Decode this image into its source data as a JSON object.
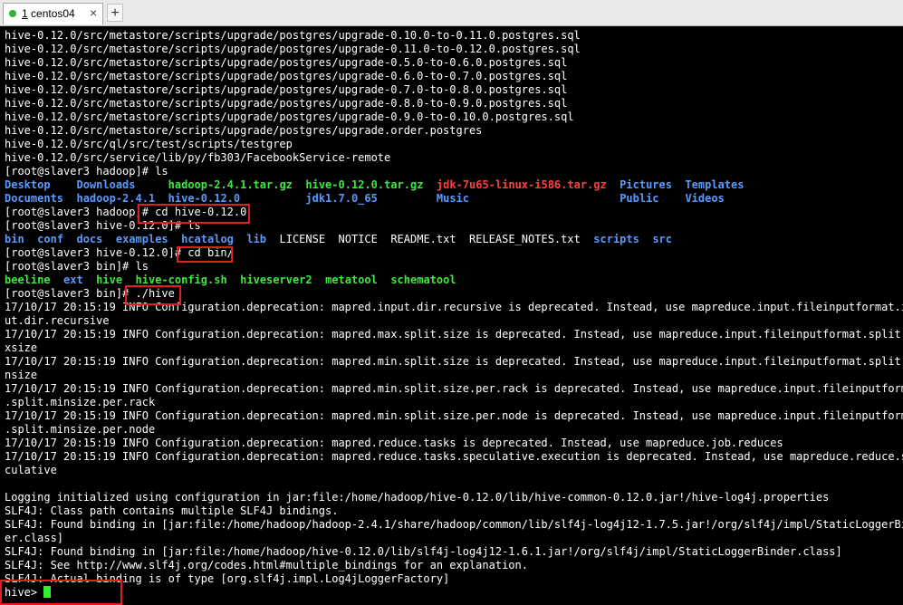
{
  "tabbar": {
    "tab_number": "1",
    "tab_title": " centos04",
    "close_glyph": "×",
    "add_glyph": "+",
    "status_color": "#2bb52b"
  },
  "terminal": {
    "colors": {
      "background": "#000000",
      "text": "#ffffff",
      "directory": "#5a9aff",
      "executable": "#3fe83f",
      "archive": "#ff4040",
      "highlight_box": "#e21f1f",
      "cursor": "#2ef22e"
    },
    "lines": [
      [
        {
          "t": "hive-0.12.0/src/metastore/scripts/upgrade/postgres/upgrade-0.10.0-to-0.11.0.postgres.sql",
          "c": "w"
        }
      ],
      [
        {
          "t": "hive-0.12.0/src/metastore/scripts/upgrade/postgres/upgrade-0.11.0-to-0.12.0.postgres.sql",
          "c": "w"
        }
      ],
      [
        {
          "t": "hive-0.12.0/src/metastore/scripts/upgrade/postgres/upgrade-0.5.0-to-0.6.0.postgres.sql",
          "c": "w"
        }
      ],
      [
        {
          "t": "hive-0.12.0/src/metastore/scripts/upgrade/postgres/upgrade-0.6.0-to-0.7.0.postgres.sql",
          "c": "w"
        }
      ],
      [
        {
          "t": "hive-0.12.0/src/metastore/scripts/upgrade/postgres/upgrade-0.7.0-to-0.8.0.postgres.sql",
          "c": "w"
        }
      ],
      [
        {
          "t": "hive-0.12.0/src/metastore/scripts/upgrade/postgres/upgrade-0.8.0-to-0.9.0.postgres.sql",
          "c": "w"
        }
      ],
      [
        {
          "t": "hive-0.12.0/src/metastore/scripts/upgrade/postgres/upgrade-0.9.0-to-0.10.0.postgres.sql",
          "c": "w"
        }
      ],
      [
        {
          "t": "hive-0.12.0/src/metastore/scripts/upgrade/postgres/upgrade.order.postgres",
          "c": "w"
        }
      ],
      [
        {
          "t": "hive-0.12.0/src/ql/src/test/scripts/testgrep",
          "c": "w"
        }
      ],
      [
        {
          "t": "hive-0.12.0/src/service/lib/py/fb303/FacebookService-remote",
          "c": "w"
        }
      ],
      [
        {
          "t": "[root@slaver3 hadoop]# ls",
          "c": "w"
        }
      ],
      [
        {
          "t": "Desktop",
          "c": "b"
        },
        {
          "t": "    ",
          "c": "w"
        },
        {
          "t": "Downloads",
          "c": "b"
        },
        {
          "t": "     ",
          "c": "w"
        },
        {
          "t": "hadoop-2.4.1.tar.gz",
          "c": "g"
        },
        {
          "t": "  ",
          "c": "w"
        },
        {
          "t": "hive-0.12.0.tar.gz",
          "c": "g"
        },
        {
          "t": "  ",
          "c": "w"
        },
        {
          "t": "jdk-7u65-linux-i586.tar.gz",
          "c": "r"
        },
        {
          "t": "  ",
          "c": "w"
        },
        {
          "t": "Pictures",
          "c": "b"
        },
        {
          "t": "  ",
          "c": "w"
        },
        {
          "t": "Templates",
          "c": "b"
        }
      ],
      [
        {
          "t": "Documents",
          "c": "b"
        },
        {
          "t": "  ",
          "c": "w"
        },
        {
          "t": "hadoop-2.4.1",
          "c": "b"
        },
        {
          "t": "  ",
          "c": "w"
        },
        {
          "t": "hive-0.12.0",
          "c": "b"
        },
        {
          "t": "          ",
          "c": "w"
        },
        {
          "t": "jdk1.7.0_65",
          "c": "b"
        },
        {
          "t": "         ",
          "c": "w"
        },
        {
          "t": "Music",
          "c": "b"
        },
        {
          "t": "                       ",
          "c": "w"
        },
        {
          "t": "Public",
          "c": "b"
        },
        {
          "t": "    ",
          "c": "w"
        },
        {
          "t": "Videos",
          "c": "b"
        }
      ],
      [
        {
          "t": "[root@slaver3 hadoop]# cd hive-0.12.0",
          "c": "w"
        }
      ],
      [
        {
          "t": "[root@slaver3 hive-0.12.0]# ls",
          "c": "w"
        }
      ],
      [
        {
          "t": "bin",
          "c": "b"
        },
        {
          "t": "  ",
          "c": "w"
        },
        {
          "t": "conf",
          "c": "b"
        },
        {
          "t": "  ",
          "c": "w"
        },
        {
          "t": "docs",
          "c": "b"
        },
        {
          "t": "  ",
          "c": "w"
        },
        {
          "t": "examples",
          "c": "b"
        },
        {
          "t": "  ",
          "c": "w"
        },
        {
          "t": "hcatalog",
          "c": "b"
        },
        {
          "t": "  ",
          "c": "w"
        },
        {
          "t": "lib",
          "c": "b"
        },
        {
          "t": "  LICENSE  NOTICE  README.txt  RELEASE_NOTES.txt  ",
          "c": "w"
        },
        {
          "t": "scripts",
          "c": "b"
        },
        {
          "t": "  ",
          "c": "w"
        },
        {
          "t": "src",
          "c": "b"
        }
      ],
      [
        {
          "t": "[root@slaver3 hive-0.12.0]# cd bin/",
          "c": "w"
        }
      ],
      [
        {
          "t": "[root@slaver3 bin]# ls",
          "c": "w"
        }
      ],
      [
        {
          "t": "beeline",
          "c": "g"
        },
        {
          "t": "  ",
          "c": "w"
        },
        {
          "t": "ext",
          "c": "b"
        },
        {
          "t": "  ",
          "c": "w"
        },
        {
          "t": "hive",
          "c": "g"
        },
        {
          "t": "  ",
          "c": "w"
        },
        {
          "t": "hive-config.sh",
          "c": "g"
        },
        {
          "t": "  ",
          "c": "w"
        },
        {
          "t": "hiveserver2",
          "c": "g"
        },
        {
          "t": "  ",
          "c": "w"
        },
        {
          "t": "metatool",
          "c": "g"
        },
        {
          "t": "  ",
          "c": "w"
        },
        {
          "t": "schematool",
          "c": "g"
        }
      ],
      [
        {
          "t": "[root@slaver3 bin]# ./hive",
          "c": "w"
        }
      ],
      [
        {
          "t": "17/10/17 20:15:19 INFO Configuration.deprecation: mapred.input.dir.recursive is deprecated. Instead, use mapreduce.input.fileinputformat.inp",
          "c": "w"
        }
      ],
      [
        {
          "t": "ut.dir.recursive",
          "c": "w"
        }
      ],
      [
        {
          "t": "17/10/17 20:15:19 INFO Configuration.deprecation: mapred.max.split.size is deprecated. Instead, use mapreduce.input.fileinputformat.split.ma",
          "c": "w"
        }
      ],
      [
        {
          "t": "xsize",
          "c": "w"
        }
      ],
      [
        {
          "t": "17/10/17 20:15:19 INFO Configuration.deprecation: mapred.min.split.size is deprecated. Instead, use mapreduce.input.fileinputformat.split.mi",
          "c": "w"
        }
      ],
      [
        {
          "t": "nsize",
          "c": "w"
        }
      ],
      [
        {
          "t": "17/10/17 20:15:19 INFO Configuration.deprecation: mapred.min.split.size.per.rack is deprecated. Instead, use mapreduce.input.fileinputformat",
          "c": "w"
        }
      ],
      [
        {
          "t": ".split.minsize.per.rack",
          "c": "w"
        }
      ],
      [
        {
          "t": "17/10/17 20:15:19 INFO Configuration.deprecation: mapred.min.split.size.per.node is deprecated. Instead, use mapreduce.input.fileinputformat",
          "c": "w"
        }
      ],
      [
        {
          "t": ".split.minsize.per.node",
          "c": "w"
        }
      ],
      [
        {
          "t": "17/10/17 20:15:19 INFO Configuration.deprecation: mapred.reduce.tasks is deprecated. Instead, use mapreduce.job.reduces",
          "c": "w"
        }
      ],
      [
        {
          "t": "17/10/17 20:15:19 INFO Configuration.deprecation: mapred.reduce.tasks.speculative.execution is deprecated. Instead, use mapreduce.reduce.spe",
          "c": "w"
        }
      ],
      [
        {
          "t": "culative",
          "c": "w"
        }
      ],
      [
        {
          "t": "",
          "c": "w"
        }
      ],
      [
        {
          "t": "Logging initialized using configuration in jar:file:/home/hadoop/hive-0.12.0/lib/hive-common-0.12.0.jar!/hive-log4j.properties",
          "c": "w"
        }
      ],
      [
        {
          "t": "SLF4J: Class path contains multiple SLF4J bindings.",
          "c": "w"
        }
      ],
      [
        {
          "t": "SLF4J: Found binding in [jar:file:/home/hadoop/hadoop-2.4.1/share/hadoop/common/lib/slf4j-log4j12-1.7.5.jar!/org/slf4j/impl/StaticLoggerBind",
          "c": "w"
        }
      ],
      [
        {
          "t": "er.class]",
          "c": "w"
        }
      ],
      [
        {
          "t": "SLF4J: Found binding in [jar:file:/home/hadoop/hive-0.12.0/lib/slf4j-log4j12-1.6.1.jar!/org/slf4j/impl/StaticLoggerBinder.class]",
          "c": "w"
        }
      ],
      [
        {
          "t": "SLF4J: See http://www.slf4j.org/codes.html#multiple_bindings for an explanation.",
          "c": "w"
        }
      ],
      [
        {
          "t": "SLF4J: Actual binding is of type [org.slf4j.impl.Log4jLoggerFactory]",
          "c": "w"
        }
      ],
      [
        {
          "t": "hive> ",
          "c": "w"
        }
      ]
    ]
  }
}
